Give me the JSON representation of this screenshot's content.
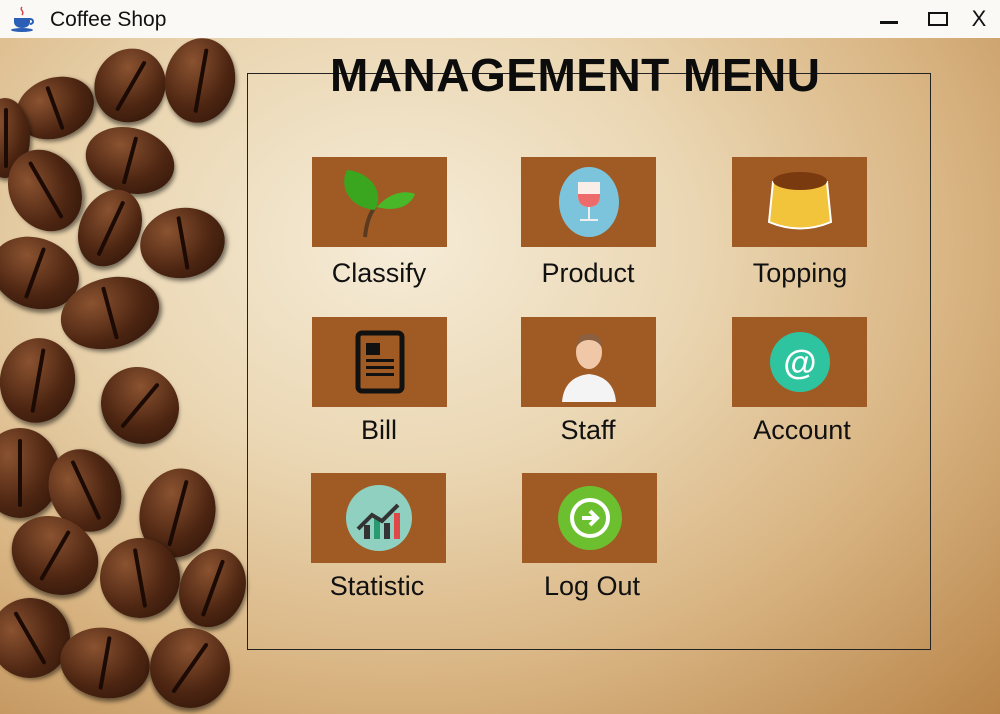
{
  "window": {
    "title": "Coffee Shop",
    "minimize": "—",
    "maximize": "☐",
    "close": "X"
  },
  "menu": {
    "title": "MANAGEMENT MENU",
    "items": [
      {
        "label": "Classify",
        "icon": "leaf-icon"
      },
      {
        "label": "Product",
        "icon": "wine-glass-icon"
      },
      {
        "label": "Topping",
        "icon": "pudding-icon"
      },
      {
        "label": "Bill",
        "icon": "receipt-icon"
      },
      {
        "label": "Staff",
        "icon": "person-icon"
      },
      {
        "label": "Account",
        "icon": "at-sign-icon"
      },
      {
        "label": "Statistic",
        "icon": "chart-icon"
      },
      {
        "label": "Log Out",
        "icon": "logout-icon"
      }
    ]
  },
  "colors": {
    "tile": "#a05a24"
  }
}
